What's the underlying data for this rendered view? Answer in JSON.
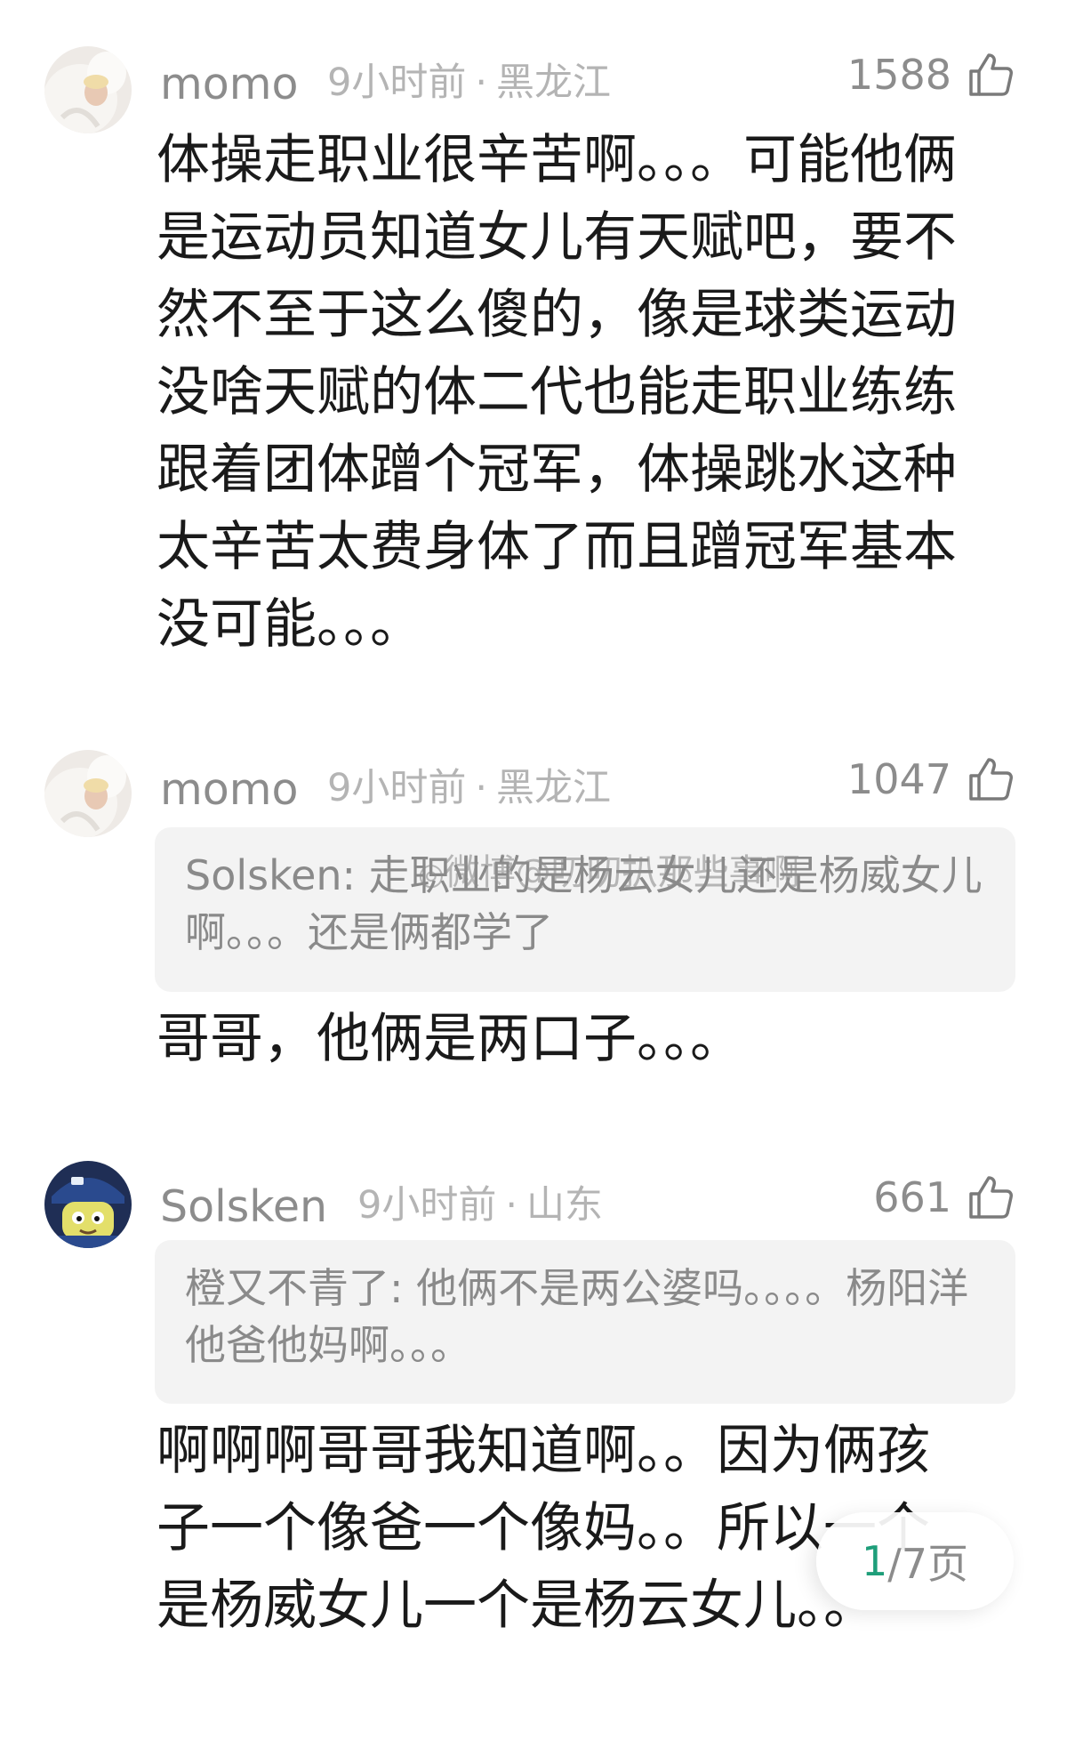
{
  "comments": [
    {
      "username": "momo",
      "time": "9小时前",
      "separator": "·",
      "location": "黑龙江",
      "likes": "1588",
      "body": "体操走职业很辛苦啊。。。可能他俩是运动员知道女儿有天赋吧，要不然不至于这么傻的，像是球类运动没啥天赋的体二代也能走职业练练跟着团体蹭个冠军，体操跳水这种太辛苦太费身体了而且蹭冠军基本没可能。。。"
    },
    {
      "username": "momo",
      "time": "9小时前",
      "separator": "·",
      "location": "黑龙江",
      "likes": "1047",
      "quote": "Solsken: 走职业的是杨云女儿还是杨威女儿啊。。。还是俩都学了",
      "body": "哥哥，他俩是两口子。。。"
    },
    {
      "username": "Solsken",
      "time": "9小时前",
      "separator": "·",
      "location": "山东",
      "likes": "661",
      "quote": "橙又不青了: 他俩不是两公婆吗。。。。杨阳洋他爸他妈啊。。。",
      "body": "啊啊啊哥哥我知道啊。。因为俩孩子一个像爸一个像妈。。所以一个是杨威女儿一个是杨云女儿。。"
    }
  ],
  "watermark": "微博@叨叨扒那些事啊",
  "pager": {
    "current": "1",
    "total_label": "/7页"
  },
  "icons": {
    "like": "thumbs-up-icon",
    "watermark": "weibo-icon"
  },
  "colors": {
    "username": "#8c8c8c",
    "meta": "#b4b4b4",
    "quote_bg": "#f3f3f3",
    "pager_current": "#1e9e7a"
  }
}
